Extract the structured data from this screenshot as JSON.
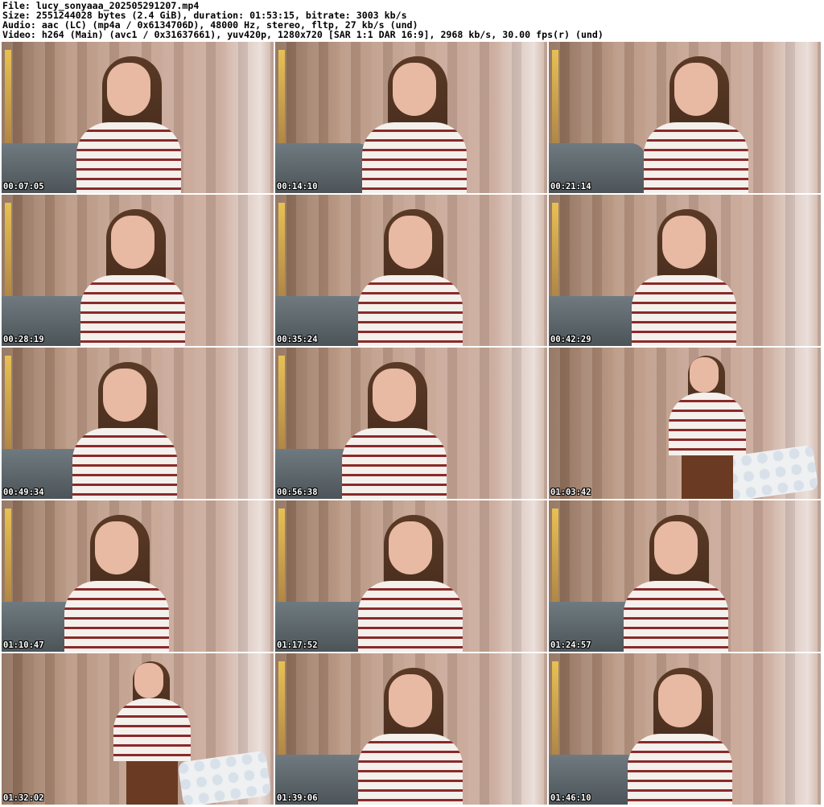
{
  "header": {
    "file": "File: lucy_sonyaaa_202505291207.mp4",
    "size": "Size: 2551244028 bytes (2.4 GiB), duration: 01:53:15, bitrate: 3003 kb/s",
    "audio": "Audio: aac (LC) (mp4a / 0x6134706D), 48000 Hz, stereo, fltp, 27 kb/s (und)",
    "video": "Video: h264 (Main) (avc1 / 0x31637661), yuv420p, 1280x720 [SAR 1:1 DAR 16:9], 2968 kb/s, 30.00 fps(r) (und)"
  },
  "thumbnails": [
    {
      "timestamp": "00:07:05"
    },
    {
      "timestamp": "00:14:10"
    },
    {
      "timestamp": "00:21:14"
    },
    {
      "timestamp": "00:28:19"
    },
    {
      "timestamp": "00:35:24"
    },
    {
      "timestamp": "00:42:29"
    },
    {
      "timestamp": "00:49:34"
    },
    {
      "timestamp": "00:56:38"
    },
    {
      "timestamp": "01:03:42"
    },
    {
      "timestamp": "01:10:47"
    },
    {
      "timestamp": "01:17:52"
    },
    {
      "timestamp": "01:24:57"
    },
    {
      "timestamp": "01:32:02"
    },
    {
      "timestamp": "01:39:06"
    },
    {
      "timestamp": "01:46:10"
    }
  ]
}
